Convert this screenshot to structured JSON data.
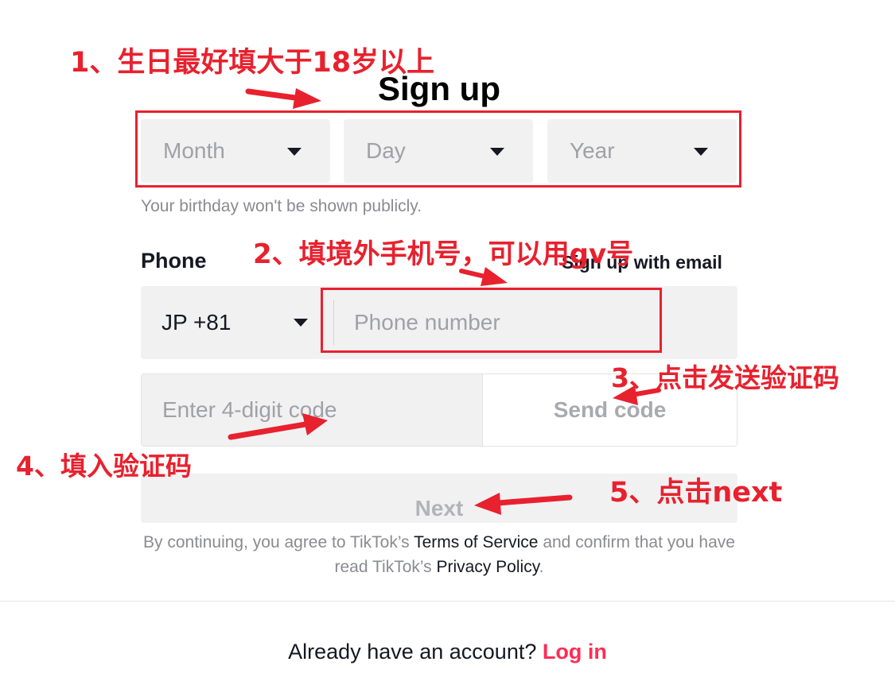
{
  "form": {
    "title": "Sign up",
    "birthday": {
      "month_placeholder": "Month",
      "day_placeholder": "Day",
      "year_placeholder": "Year",
      "helper_text": "Your birthday won't be shown publicly."
    },
    "phone": {
      "label": "Phone",
      "alt_link": "Sign up with email",
      "country_code": "JP +81",
      "number_placeholder": "Phone number"
    },
    "code": {
      "placeholder": "Enter 4-digit code",
      "send_label": "Send code"
    },
    "next_label": "Next",
    "legal": {
      "prefix": "By continuing, you agree to TikTok’s ",
      "terms_link": "Terms of Service",
      "middle": " and confirm that you have read TikTok’s ",
      "privacy_link": "Privacy Policy",
      "suffix": "."
    },
    "footer": {
      "prompt": "Already have an account? ",
      "login_link": "Log in"
    }
  },
  "annotations": {
    "step1": "1、生日最好填大于18岁以上",
    "step2": "2、填境外手机号，可以用gv号",
    "step3": "3、点击发送验证码",
    "step4": "4、填入验证码",
    "step5": "5、点击next",
    "color": "#e8212e"
  },
  "colors": {
    "field_bg": "#f1f1f2",
    "placeholder": "#a0a1a6",
    "text": "#161823",
    "brand_pink": "#fe2c55"
  },
  "icons": {
    "dropdown": "caret-down-icon",
    "arrow": "red-arrow-icon"
  }
}
